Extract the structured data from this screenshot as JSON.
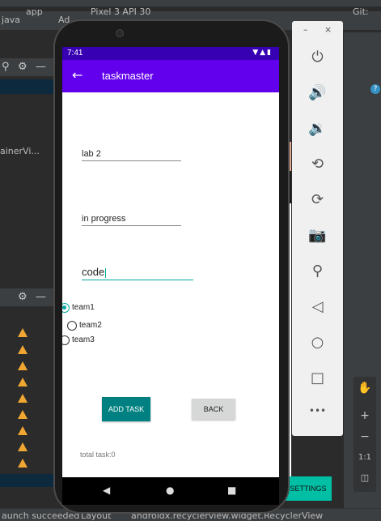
{
  "ide": {
    "tabs": [
      "app",
      "Pixel 3 API 30",
      "Ad",
      "Git:"
    ],
    "file_tab": "java",
    "left_panel_text": "ainerVi...",
    "status_left": "aunch succeeded",
    "status_mid": "Layout",
    "status_right": "androidx.recyclerview.widget.RecyclerView",
    "help_icon": "?"
  },
  "device": {
    "status_time": "7:41",
    "app_title": "taskmaster",
    "fields": {
      "title": "lab 2",
      "state": "in progress",
      "body": "code"
    },
    "radios": [
      {
        "label": "team1",
        "checked": true
      },
      {
        "label": "team2",
        "checked": false
      },
      {
        "label": "team3",
        "checked": false
      }
    ],
    "add_button": "ADD TASK",
    "back_button": "BACK",
    "total_label": "total task:0"
  },
  "emulator_controls": {
    "minimize": "–",
    "close": "×",
    "icons": [
      "power-icon",
      "volume-up-icon",
      "volume-down-icon",
      "rotate-left-icon",
      "rotate-right-icon",
      "camera-icon",
      "zoom-icon",
      "back-icon",
      "home-icon",
      "overview-icon",
      "more-icon"
    ],
    "more": "•••"
  },
  "zoom_panel": {
    "plus": "+",
    "minus": "−",
    "ratio": "1:1"
  },
  "settings_button": "SETTINGS",
  "colors": {
    "appbar": "#6200ee",
    "statusbar": "#3700b3",
    "accent": "#03a9a0",
    "add_button": "#008080"
  }
}
